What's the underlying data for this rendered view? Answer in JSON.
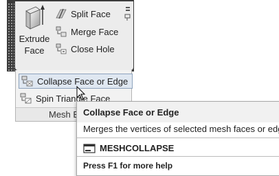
{
  "ribbon": {
    "large_button": {
      "label_line1": "Extrude",
      "label_line2": "Face",
      "icon": "extrude-face-icon"
    },
    "small_buttons": [
      {
        "label": "Split Face",
        "icon": "split-face-icon"
      },
      {
        "label": "Merge Face",
        "icon": "merge-face-icon"
      },
      {
        "label": "Close Hole",
        "icon": "close-hole-icon"
      }
    ],
    "pin_icon": "pin-icon"
  },
  "dropdown": {
    "items": [
      {
        "label": "Collapse Face or Edge",
        "icon": "collapse-face-icon",
        "state": "hover"
      },
      {
        "label": "Spin Triangle Face",
        "icon": "spin-triangle-face-icon"
      }
    ],
    "panel_title": "Mesh Edit"
  },
  "tooltip": {
    "title": "Collapse Face or Edge",
    "description": "Merges the vertices of selected mesh faces or edges",
    "command": "MESHCOLLAPSE",
    "help": "Press F1 for more help"
  },
  "colors": {
    "ribbon_dark": "#3b3b3b",
    "panel_bg": "#ececec",
    "hover_bg": "#dfe7f1",
    "hover_border": "#8da3bd"
  }
}
